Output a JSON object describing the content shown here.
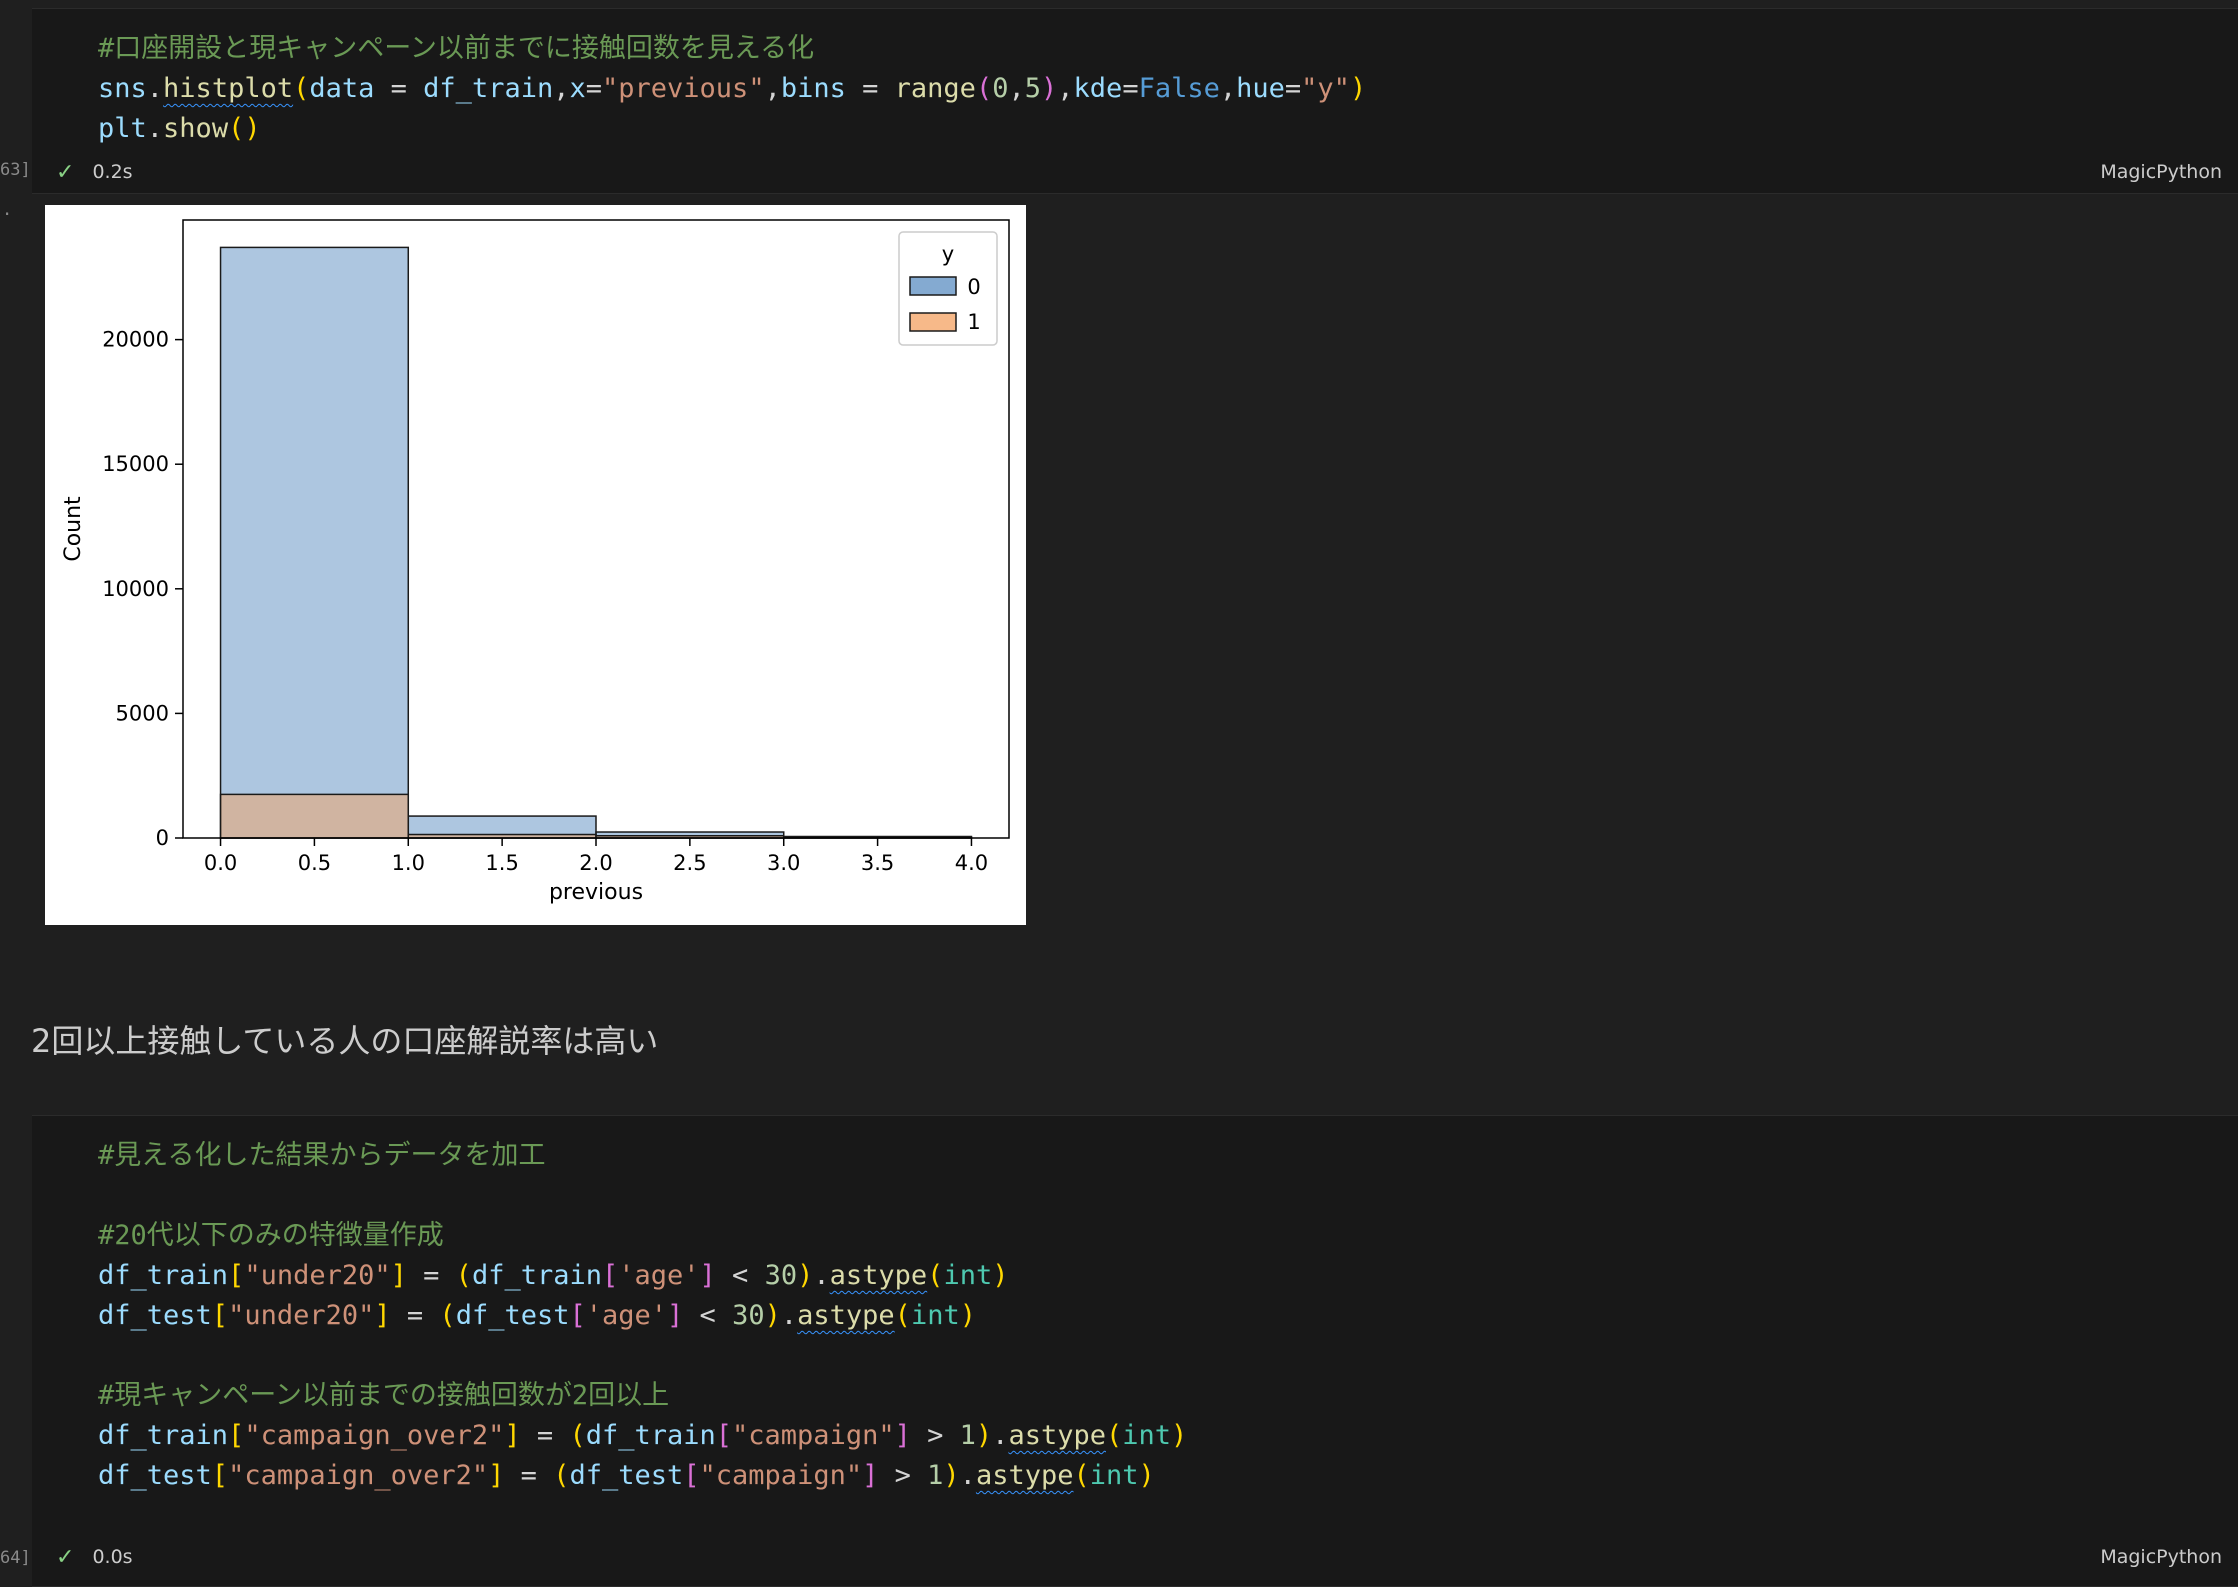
{
  "cell1": {
    "exec_count": "63]",
    "code_lines": [
      "#口座開設と現キャンペーン以前までに接触回数を見える化",
      "sns.histplot(data = df_train,x=\"previous\",bins = range(0,5),kde=False,hue=\"y\")",
      "plt.show()"
    ],
    "status_time": "0.2s",
    "language": "MagicPython"
  },
  "output_marker": ".",
  "chart_data": {
    "type": "bar",
    "title": "",
    "xlabel": "previous",
    "ylabel": "Count",
    "xlim": [
      -0.2,
      4.2
    ],
    "ylim": [
      0,
      24800
    ],
    "x_ticks": [
      "0.0",
      "0.5",
      "1.0",
      "1.5",
      "2.0",
      "2.5",
      "3.0",
      "3.5",
      "4.0"
    ],
    "y_ticks": [
      "0",
      "5000",
      "10000",
      "15000",
      "20000"
    ],
    "bin_edges": [
      0,
      1,
      2,
      3,
      4
    ],
    "legend": {
      "title": "y",
      "placement": "top-right",
      "entries": [
        "0",
        "1"
      ]
    },
    "series": [
      {
        "name": "0",
        "color": "#5b8ec1",
        "values": [
          23700,
          880,
          240,
          60
        ]
      },
      {
        "name": "1",
        "color": "#f4a261",
        "values": [
          1750,
          140,
          90,
          30
        ]
      }
    ]
  },
  "markdown": {
    "text": "2回以上接触している人の口座解説率は高い"
  },
  "cell2": {
    "exec_count": "64]",
    "code_lines": [
      "#見える化した結果からデータを加工",
      "",
      "#20代以下のみの特徴量作成",
      "df_train[\"under20\"] = (df_train['age'] < 30).astype(int)",
      "df_test[\"under20\"] = (df_test['age'] < 30).astype(int)",
      "",
      "#現キャンペーン以前までの接触回数が2回以上",
      "df_train[\"campaign_over2\"] = (df_train[\"campaign\"] > 1).astype(int)",
      "df_test[\"campaign_over2\"] = (df_test[\"campaign\"] > 1).astype(int)"
    ],
    "status_time": "0.0s",
    "language": "MagicPython"
  }
}
